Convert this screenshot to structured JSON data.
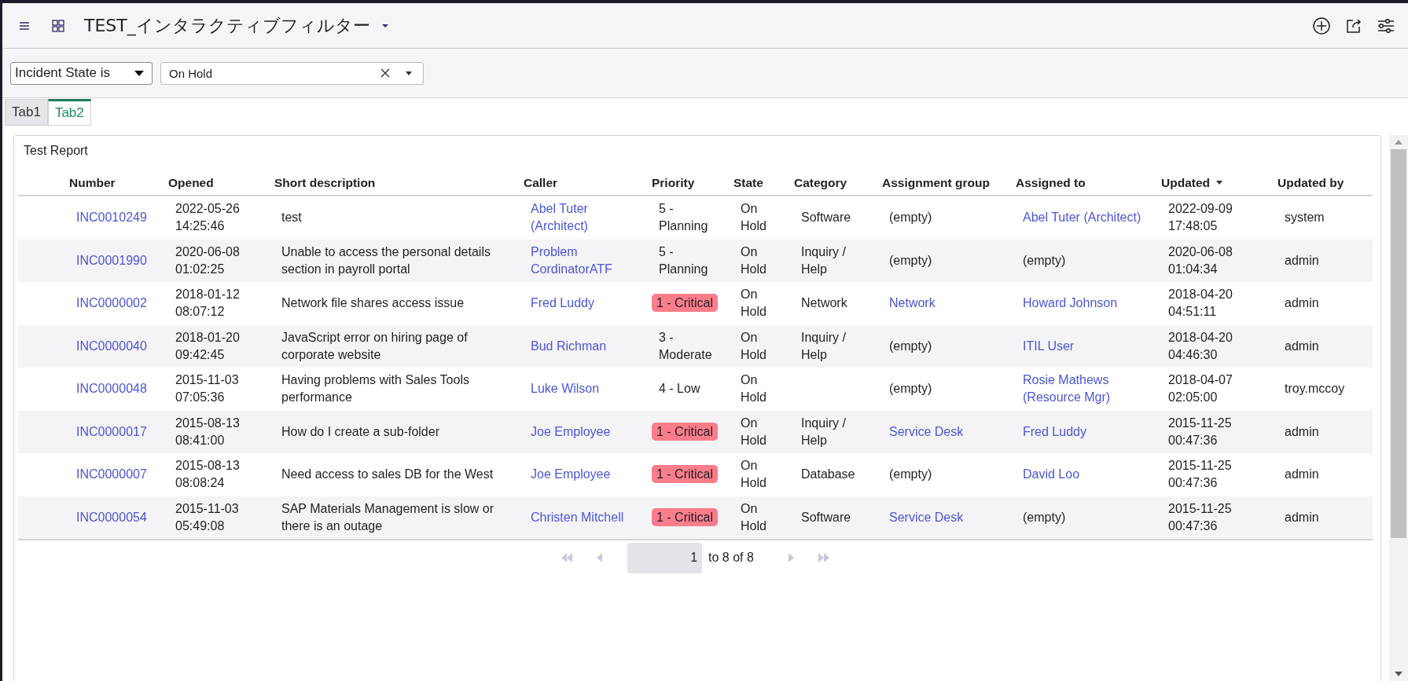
{
  "header": {
    "title": "TEST_インタラクティブフィルター"
  },
  "filter": {
    "field": "Incident State is",
    "value": "On Hold"
  },
  "tabs": [
    {
      "label": "Tab1",
      "selected": false
    },
    {
      "label": "Tab2",
      "selected": true
    }
  ],
  "report": {
    "title": "Test Report",
    "columns": [
      {
        "label": "Number",
        "sorted": false
      },
      {
        "label": "Opened",
        "sorted": false
      },
      {
        "label": "Short description",
        "sorted": false
      },
      {
        "label": "Caller",
        "sorted": false
      },
      {
        "label": "Priority",
        "sorted": false
      },
      {
        "label": "State",
        "sorted": false
      },
      {
        "label": "Category",
        "sorted": false
      },
      {
        "label": "Assignment group",
        "sorted": false
      },
      {
        "label": "Assigned to",
        "sorted": false
      },
      {
        "label": "Updated",
        "sorted": true
      },
      {
        "label": "Updated by",
        "sorted": false
      }
    ],
    "rows": [
      {
        "cells": [
          {
            "kind": "link",
            "text": "INC0010249"
          },
          {
            "kind": "text",
            "text": "2022-05-26 14:25:46"
          },
          {
            "kind": "text",
            "text": "test"
          },
          {
            "kind": "link",
            "text": "Abel Tuter (Architect)"
          },
          {
            "kind": "text",
            "text": "5 - Planning"
          },
          {
            "kind": "text",
            "text": "On Hold"
          },
          {
            "kind": "text",
            "text": "Software"
          },
          {
            "kind": "text",
            "text": "(empty)"
          },
          {
            "kind": "link",
            "text": "Abel Tuter (Architect)"
          },
          {
            "kind": "text",
            "text": "2022-09-09 17:48:05"
          },
          {
            "kind": "text",
            "text": "system"
          }
        ]
      },
      {
        "cells": [
          {
            "kind": "link",
            "text": "INC0001990"
          },
          {
            "kind": "text",
            "text": "2020-06-08 01:02:25"
          },
          {
            "kind": "text",
            "text": "Unable to access the personal details section in payroll portal"
          },
          {
            "kind": "link",
            "text": "Problem CordinatorATF"
          },
          {
            "kind": "text",
            "text": "5 - Planning"
          },
          {
            "kind": "text",
            "text": "On Hold"
          },
          {
            "kind": "text",
            "text": "Inquiry / Help"
          },
          {
            "kind": "text",
            "text": "(empty)"
          },
          {
            "kind": "text",
            "text": "(empty)"
          },
          {
            "kind": "text",
            "text": "2020-06-08 01:04:34"
          },
          {
            "kind": "text",
            "text": "admin"
          }
        ]
      },
      {
        "cells": [
          {
            "kind": "link",
            "text": "INC0000002"
          },
          {
            "kind": "text",
            "text": "2018-01-12 08:07:12"
          },
          {
            "kind": "text",
            "text": "Network file shares access issue"
          },
          {
            "kind": "link",
            "text": "Fred Luddy"
          },
          {
            "kind": "badge",
            "text": "1 - Critical"
          },
          {
            "kind": "text",
            "text": "On Hold"
          },
          {
            "kind": "text",
            "text": "Network"
          },
          {
            "kind": "link",
            "text": "Network"
          },
          {
            "kind": "link",
            "text": "Howard Johnson"
          },
          {
            "kind": "text",
            "text": "2018-04-20 04:51:11"
          },
          {
            "kind": "text",
            "text": "admin"
          }
        ]
      },
      {
        "cells": [
          {
            "kind": "link",
            "text": "INC0000040"
          },
          {
            "kind": "text",
            "text": "2018-01-20 09:42:45"
          },
          {
            "kind": "text",
            "text": "JavaScript error on hiring page of corporate website"
          },
          {
            "kind": "link",
            "text": "Bud Richman"
          },
          {
            "kind": "text",
            "text": "3 - Moderate"
          },
          {
            "kind": "text",
            "text": "On Hold"
          },
          {
            "kind": "text",
            "text": "Inquiry / Help"
          },
          {
            "kind": "text",
            "text": "(empty)"
          },
          {
            "kind": "link",
            "text": "ITIL User"
          },
          {
            "kind": "text",
            "text": "2018-04-20 04:46:30"
          },
          {
            "kind": "text",
            "text": "admin"
          }
        ]
      },
      {
        "cells": [
          {
            "kind": "link",
            "text": "INC0000048"
          },
          {
            "kind": "text",
            "text": "2015-11-03 07:05:36"
          },
          {
            "kind": "text",
            "text": "Having problems with Sales Tools performance"
          },
          {
            "kind": "link",
            "text": "Luke Wilson"
          },
          {
            "kind": "text",
            "text": "4 - Low"
          },
          {
            "kind": "text",
            "text": "On Hold"
          },
          {
            "kind": "blank"
          },
          {
            "kind": "text",
            "text": "(empty)"
          },
          {
            "kind": "link",
            "text": "Rosie Mathews (Resource Mgr)"
          },
          {
            "kind": "text",
            "text": "2018-04-07 02:05:00"
          },
          {
            "kind": "text",
            "text": "troy.mccoy"
          }
        ]
      },
      {
        "cells": [
          {
            "kind": "link",
            "text": "INC0000017"
          },
          {
            "kind": "text",
            "text": "2015-08-13 08:41:00"
          },
          {
            "kind": "text",
            "text": "How do I create a sub-folder"
          },
          {
            "kind": "link",
            "text": "Joe Employee"
          },
          {
            "kind": "badge",
            "text": "1 - Critical"
          },
          {
            "kind": "text",
            "text": "On Hold"
          },
          {
            "kind": "text",
            "text": "Inquiry / Help"
          },
          {
            "kind": "link",
            "text": "Service Desk"
          },
          {
            "kind": "link",
            "text": "Fred Luddy"
          },
          {
            "kind": "text",
            "text": "2015-11-25 00:47:36"
          },
          {
            "kind": "text",
            "text": "admin"
          }
        ]
      },
      {
        "cells": [
          {
            "kind": "link",
            "text": "INC0000007"
          },
          {
            "kind": "text",
            "text": "2015-08-13 08:08:24"
          },
          {
            "kind": "text",
            "text": "Need access to sales DB for the West"
          },
          {
            "kind": "link",
            "text": "Joe Employee"
          },
          {
            "kind": "badge",
            "text": "1 - Critical"
          },
          {
            "kind": "text",
            "text": "On Hold"
          },
          {
            "kind": "text",
            "text": "Database"
          },
          {
            "kind": "text",
            "text": "(empty)"
          },
          {
            "kind": "link",
            "text": "David Loo"
          },
          {
            "kind": "text",
            "text": "2015-11-25 00:47:36"
          },
          {
            "kind": "text",
            "text": "admin"
          }
        ]
      },
      {
        "cells": [
          {
            "kind": "link",
            "text": "INC0000054"
          },
          {
            "kind": "text",
            "text": "2015-11-03 05:49:08"
          },
          {
            "kind": "text",
            "text": "SAP Materials Management is slow or there is an outage"
          },
          {
            "kind": "link",
            "text": "Christen Mitchell"
          },
          {
            "kind": "badge",
            "text": "1 - Critical"
          },
          {
            "kind": "text",
            "text": "On Hold"
          },
          {
            "kind": "text",
            "text": "Software"
          },
          {
            "kind": "link",
            "text": "Service Desk"
          },
          {
            "kind": "text",
            "text": "(empty)"
          },
          {
            "kind": "text",
            "text": "2015-11-25 00:47:36"
          },
          {
            "kind": "text",
            "text": "admin"
          }
        ]
      }
    ],
    "pagination": {
      "page": "1",
      "summary": "to 8 of 8"
    }
  }
}
